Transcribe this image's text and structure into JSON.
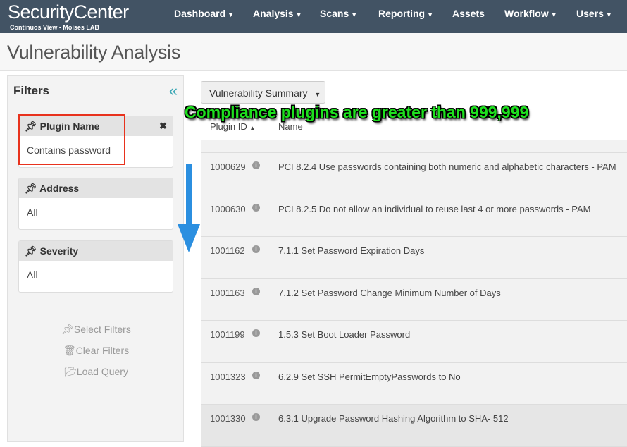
{
  "header": {
    "logo": "SecurityCenter",
    "subtitle": "Continuos View - Moises LAB",
    "nav": [
      "Dashboard",
      "Analysis",
      "Scans",
      "Reporting",
      "Assets",
      "Workflow",
      "Users"
    ]
  },
  "page_title": "Vulnerability Analysis",
  "filters": {
    "title": "Filters",
    "cards": [
      {
        "label": "Plugin Name",
        "value": "Contains password"
      },
      {
        "label": "Address",
        "value": "All"
      },
      {
        "label": "Severity",
        "value": "All"
      }
    ],
    "actions": [
      "Select Filters",
      "Clear Filters",
      "Load Query"
    ]
  },
  "main": {
    "view_select": "Vulnerability Summary",
    "annotation": "Compliance plugins are greater than 999,999",
    "columns": [
      "Plugin ID",
      "Name"
    ],
    "rows": [
      {
        "id": "1000629",
        "name": "PCI 8.2.4 Use passwords containing both numeric and alphabetic characters - PAM"
      },
      {
        "id": "1000630",
        "name": "PCI 8.2.5 Do not allow an individual to reuse last 4 or more passwords - PAM"
      },
      {
        "id": "1001162",
        "name": "7.1.1 Set Password Expiration Days"
      },
      {
        "id": "1001163",
        "name": "7.1.2 Set Password Change Minimum Number of Days"
      },
      {
        "id": "1001199",
        "name": "1.5.3 Set Boot Loader Password"
      },
      {
        "id": "1001323",
        "name": "6.2.9 Set SSH PermitEmptyPasswords to No"
      },
      {
        "id": "1001330",
        "name": "6.3.1 Upgrade Password Hashing Algorithm to SHA- 512"
      }
    ]
  },
  "colors": {
    "header": "#425364",
    "accent": "#3aa7b5",
    "highlight_box": "#e8321d",
    "annotation": "#1ee01e",
    "arrow": "#2b8fe0"
  }
}
